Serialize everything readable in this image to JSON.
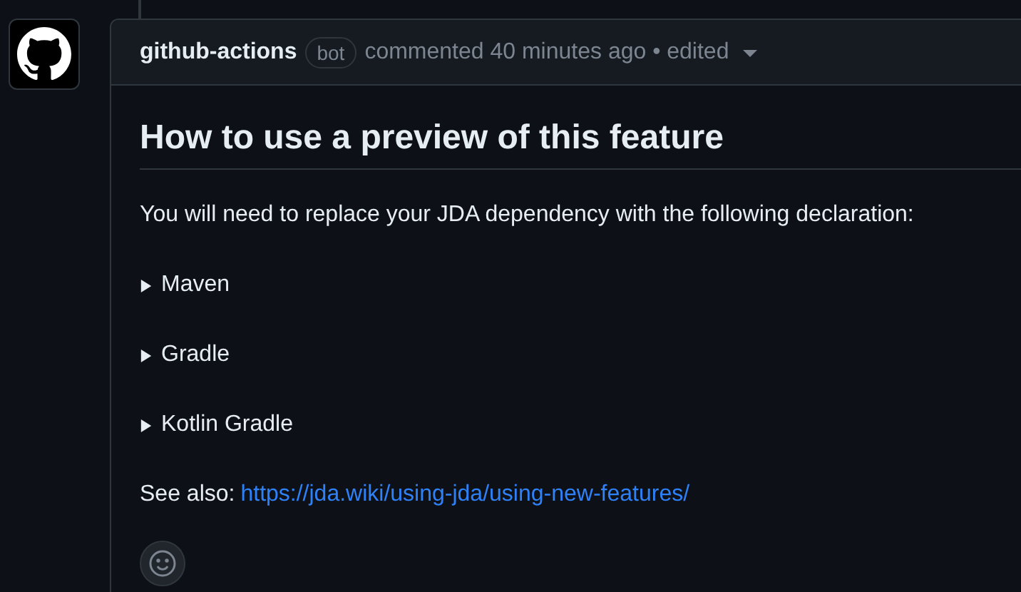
{
  "comment": {
    "author": "github-actions",
    "badge": "bot",
    "meta": "commented 40 minutes ago • edited",
    "heading": "How to use a preview of this feature",
    "intro": "You will need to replace your JDA dependency with the following declaration:",
    "sections": [
      {
        "summary": "Maven",
        "expanded": false
      },
      {
        "summary": "Gradle",
        "expanded": false
      },
      {
        "summary": "Kotlin Gradle",
        "expanded": false
      }
    ],
    "see_also": {
      "label": "See also:",
      "link": "https://jda.wiki/using-jda/using-new-features/"
    }
  }
}
